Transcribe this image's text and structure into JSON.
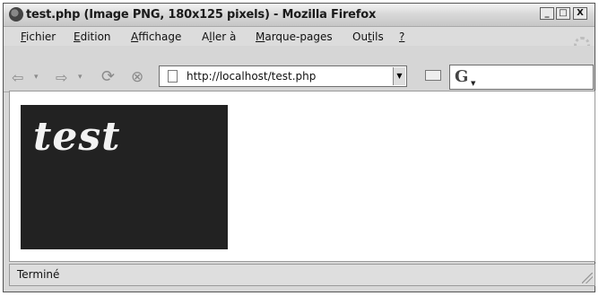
{
  "window": {
    "title": "test.php (Image PNG, 180x125 pixels) - Mozilla Firefox",
    "controls": [
      "_",
      "□",
      "X"
    ]
  },
  "menu": [
    {
      "pre": "",
      "u": "F",
      "post": "ichier"
    },
    {
      "pre": "",
      "u": "E",
      "post": "dition"
    },
    {
      "pre": "",
      "u": "A",
      "post": "ffichage"
    },
    {
      "pre": "A",
      "u": "l",
      "post": "ler à"
    },
    {
      "pre": "",
      "u": "M",
      "post": "arque-pages"
    },
    {
      "pre": "Ou",
      "u": "t",
      "post": "ils"
    },
    {
      "pre": "",
      "u": "?",
      "post": ""
    }
  ],
  "navigation": {
    "back_icon": "back-arrow-icon",
    "forward_icon": "forward-arrow-icon",
    "reload_icon": "reload-icon",
    "stop_icon": "stop-icon",
    "url": "http://localhost/test.php",
    "search_engine_logo": "G"
  },
  "content": {
    "image_text": "test",
    "image_bg": "#222222"
  },
  "status": {
    "text": "Terminé"
  }
}
